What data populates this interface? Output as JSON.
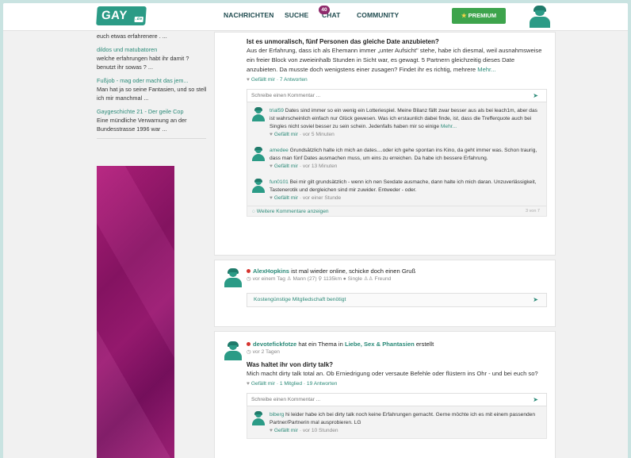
{
  "header": {
    "logo": "GAY",
    "logo_suffix": ".de",
    "nav": [
      "NACHRICHTEN",
      "SUCHE",
      "CHAT",
      "COMMUNITY"
    ],
    "chat_badge": "40",
    "premium_label": "PREMIUM"
  },
  "sidebar": {
    "items": [
      {
        "title": "",
        "text": "euch etwas erfahrenere . ..."
      },
      {
        "title": "dildos und matubatoren",
        "text": "welche erfahrungen habt ihr damit ? benutzt ihr sowas ? ..."
      },
      {
        "title": "Fußjob - mag oder macht das jem...",
        "text": "Man hat ja so seine Fantasien, und so stell ich mir manchmal ..."
      },
      {
        "title": "Gaygeschichte 21 - Der geile Cop",
        "text": "Eine mündliche Verwarnung an der Bundesstrasse 1996 war ..."
      }
    ]
  },
  "post1": {
    "title": "Ist es unmoralisch, fünf Personen das gleiche Date anzubieten?",
    "body": "Aus der Erfahrung, dass ich als Ehemann immer „unter Aufsicht\" stehe, habe ich diesmal, weil ausnahmsweise ein freier Block von zweieinhalb Stunden in Sicht war, es gewagt. 5 Partnern gleichzeitig dieses Date anzubieten. Da musste doch wenigstens einer zusagen? Findet ihr es richtig, mehrere",
    "more": "Mehr...",
    "meta_like": "Gefällt mir",
    "meta_rest": "· 7 Antworten",
    "comment_placeholder": "Schreibe einen Kommentar ...",
    "comments": [
      {
        "user": "trial59",
        "text": " Dates sind immer so ein wenig ein Lotteriespiel. Meine Bilanz fällt zwar besser aus als bei leach1m, aber das ist wahrscheinlich einfach nur Glück gewesen. Was ich erstaunlich dabei finde, ist, dass die Trefferquote auch bei Singles nicht soviel besser zu sein schein. Jedenfalls haben mir so einige",
        "more": "Mehr...",
        "like": "Gefällt mir",
        "time": "· vor 5 Minuten"
      },
      {
        "user": "amedee",
        "text": " Grundsätzlich halte ich mich an dates....oder ich gehe spontan ins Kino, da geht immer was. Schon traurig, dass man fünf Dates ausmachen muss, um eins zu erreichen. Da habe ich bessere Erfahrung.",
        "more": "",
        "like": "Gefällt mir",
        "time": "· vor 13 Minuten"
      },
      {
        "user": "fun0101",
        "text": " Bei mir gilt grundsätzlich - wenn ich nen Sexdate ausmache, dann halte ich mich daran. Unzuverlässigkeit, Tastenerotik und dergleichen sind mir zuwider. Entweder - oder.",
        "more": "",
        "like": "Gefällt mir",
        "time": "· vor einer Stunde"
      }
    ],
    "more_comments": "Weitere Kommentare anzeigen",
    "count": "3 von 7"
  },
  "post2": {
    "user": "AlexHopkins",
    "status": " ist mal wieder online, schicke doch einen Gruß",
    "info": "vor einem Tag  ♙ Mann (27)  ⚲ 1135km  ● Single  ♙♙ Freund",
    "cta": "Kostengünstige Mitgliedschaft benötigt"
  },
  "post3": {
    "user": "devotefickfotze",
    "mid": " hat ein Thema in ",
    "topic": "Liebe, Sex & Phantasien",
    "end": " erstellt",
    "time": "vor 2 Tagen",
    "title": "Was haltet ihr von dirty talk?",
    "body": "Mich macht dirty talk total an. Ob Erniedrigung oder versaute Befehle oder flüstern ins Ohr - und bei euch so?",
    "meta_like": "Gefällt mir",
    "meta_rest": "· 1 Mitglied · 19 Antworten",
    "comment_placeholder": "Schreibe einen Kommentar ...",
    "comment": {
      "user": "biberg",
      "text": " hi leider habe ich bei dirty talk noch keine Erfahrungen gemacht. Gerne möchte ich es mit einem passenden Partner/Partnerin mal ausprobieren. LG",
      "like": "Gefällt mir",
      "time": "· vor 10 Stunden"
    }
  },
  "colors": {
    "accent": "#2b9b86",
    "premium": "#3da44c",
    "badge": "#8e2a6b",
    "ad": "#9c1a73"
  }
}
